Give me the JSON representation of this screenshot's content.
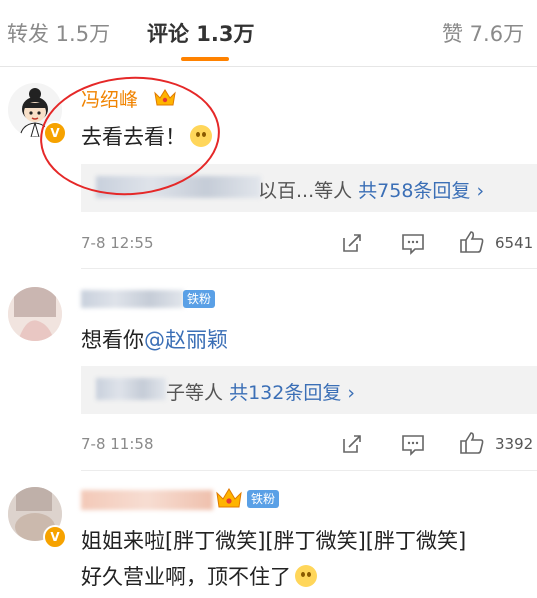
{
  "tabs": {
    "repost": "转发 1.5万",
    "comment": "评论 1.3万",
    "like": "赞 7.6万"
  },
  "comments": [
    {
      "name": "冯绍峰",
      "content": "去看去看！",
      "reply_prefix": "以百...等人",
      "reply_count": "共758条回复 ›",
      "time": "7-8 12:55",
      "likes": "6541"
    },
    {
      "badge": "铁粉",
      "content_prefix": "想看你",
      "mention": "@赵丽颖",
      "reply_prefix": "子等人",
      "reply_count": "共132条回复 ›",
      "time": "7-8 11:58",
      "likes": "3392"
    },
    {
      "badge": "铁粉",
      "content_line1": "姐姐来啦[胖丁微笑][胖丁微笑][胖丁微笑]",
      "content_line2": "好久营业啊，顶不住了"
    }
  ],
  "colors": {
    "accent": "#ff8200",
    "name": "#f08300",
    "link": "#3b6fb6",
    "annotation_circle": "#e52828"
  }
}
